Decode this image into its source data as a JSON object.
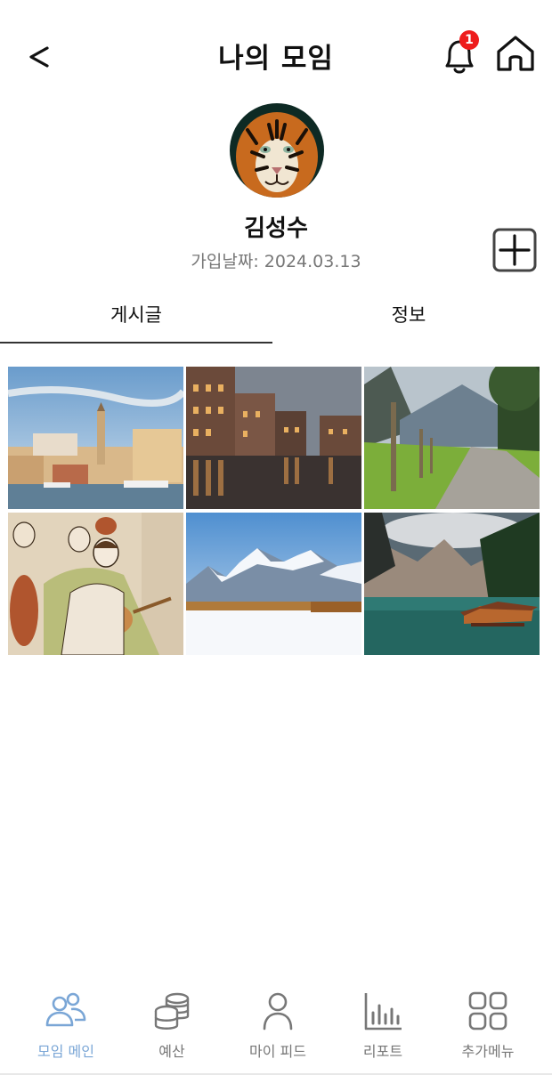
{
  "header": {
    "title": "나의 모임",
    "notification_count": "1",
    "back_icon": "chevron-left-icon",
    "bell_icon": "bell-icon",
    "home_icon": "home-icon"
  },
  "profile": {
    "name": "김성수",
    "join_label": "가입날짜: 2024.03.13",
    "avatar_description": "tiger"
  },
  "tabs": [
    {
      "label": "게시글",
      "active": true
    },
    {
      "label": "정보",
      "active": false
    }
  ],
  "photos": [
    {
      "subject": "coastal-town"
    },
    {
      "subject": "canal-buildings"
    },
    {
      "subject": "mountain-path"
    },
    {
      "subject": "musicians-illustration"
    },
    {
      "subject": "snowy-mountains"
    },
    {
      "subject": "alpine-lake-cabin"
    }
  ],
  "bottom_nav": [
    {
      "label": "모임 메인",
      "icon": "people-icon",
      "active": true
    },
    {
      "label": "예산",
      "icon": "coins-icon",
      "active": false
    },
    {
      "label": "마이 피드",
      "icon": "person-icon",
      "active": false
    },
    {
      "label": "리포트",
      "icon": "bar-chart-icon",
      "active": false
    },
    {
      "label": "추가메뉴",
      "icon": "grid-menu-icon",
      "active": false
    }
  ],
  "colors": {
    "accent": "#7aa6d6",
    "badge": "#ee1c1c",
    "muted": "#777777"
  }
}
